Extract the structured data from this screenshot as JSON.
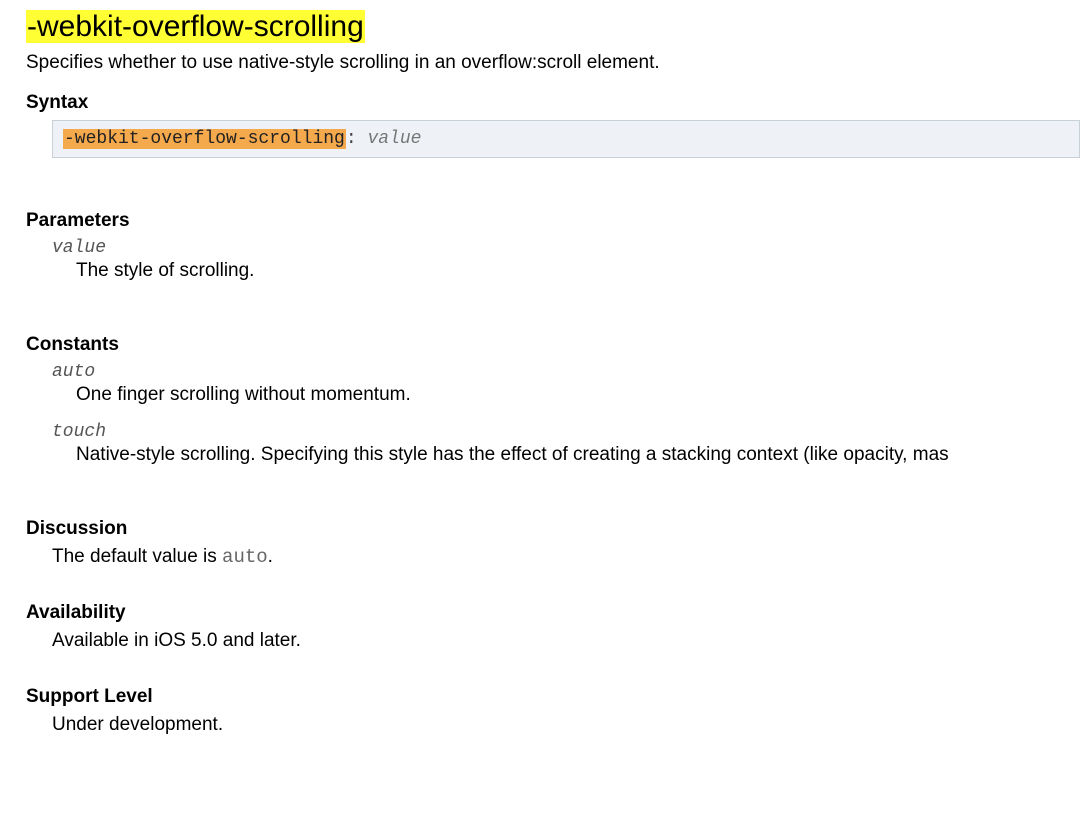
{
  "title": "-webkit-overflow-scrolling",
  "summary": "Specifies whether to use native-style scrolling in an overflow:scroll element.",
  "syntax": {
    "heading": "Syntax",
    "property": "-webkit-overflow-scrolling",
    "separator": ":  ",
    "value_placeholder": "value"
  },
  "parameters": {
    "heading": "Parameters",
    "items": [
      {
        "name": "value",
        "desc": "The style of scrolling."
      }
    ]
  },
  "constants": {
    "heading": "Constants",
    "items": [
      {
        "name": "auto",
        "desc": "One finger scrolling without momentum."
      },
      {
        "name": "touch",
        "desc": "Native-style scrolling. Specifying this style has the effect of creating a stacking context (like opacity, mas"
      }
    ]
  },
  "discussion": {
    "heading": "Discussion",
    "text_prefix": "The default value is ",
    "code": "auto",
    "text_suffix": "."
  },
  "availability": {
    "heading": "Availability",
    "text": "Available in iOS 5.0 and later."
  },
  "support_level": {
    "heading": "Support Level",
    "text": "Under development."
  }
}
